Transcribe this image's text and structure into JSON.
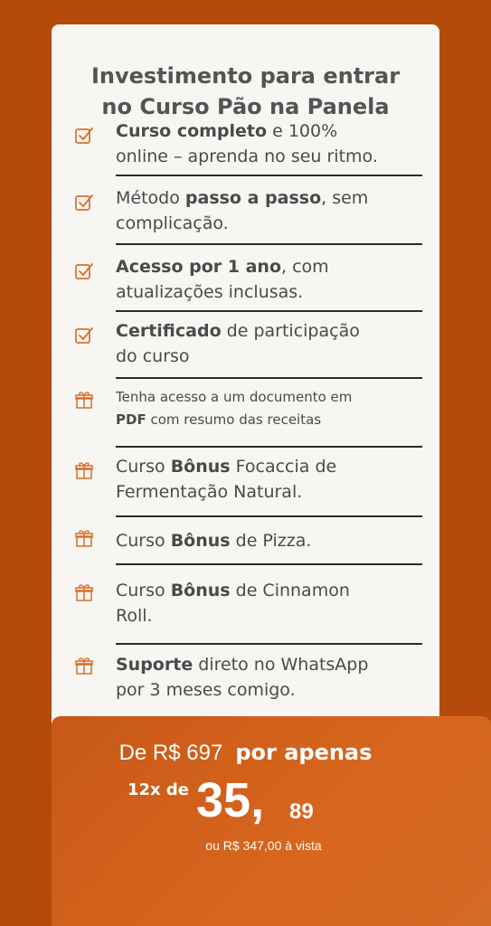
{
  "title": {
    "line1": "Investimento para entrar",
    "line2": "no Curso Pão na Panela"
  },
  "items": [
    {
      "icon": "checkbox-icon",
      "bold1": "Curso completo",
      "text1": " e 100%",
      "line2": "online – aprenda no seu ritmo."
    },
    {
      "icon": "checkbox-icon",
      "pre": "Método ",
      "bold1": "passo a passo",
      "text1": ", sem",
      "line2": "complicação."
    },
    {
      "icon": "checkbox-icon",
      "bold1": "Acesso por 1 ano",
      "text1": ", com",
      "line2": "atualizações inclusas."
    },
    {
      "icon": "checkbox-icon",
      "bold1": "Certificado",
      "text1": " de participação",
      "line2": "do curso"
    },
    {
      "icon": "gift-icon",
      "text1": "Tenha acesso a um documento em",
      "bold2": "PDF",
      "line2": " com resumo das receitas"
    },
    {
      "icon": "gift-icon",
      "pre": "Curso ",
      "bold1": "Bônus",
      "text1": " Focaccia de",
      "line2": "Fermentação Natural."
    },
    {
      "icon": "gift-icon",
      "pre": "Curso ",
      "bold1": "Bônus",
      "text1": " de Pizza."
    },
    {
      "icon": "gift-icon",
      "pre": "Curso ",
      "bold1": "Bônus",
      "text1": " de Cinnamon",
      "line2": "Roll."
    },
    {
      "icon": "gift-icon",
      "bold1": "Suporte",
      "text1": " direto no WhatsApp",
      "line2": "por  3 meses comigo."
    }
  ],
  "price": {
    "from": "De R$ 697",
    "only": "por apenas",
    "installments": "12x de",
    "amount": "35,",
    "cents": "89",
    "cash": "ou R$ 347,00 à vista"
  },
  "colors": {
    "background": "#b54b0a",
    "accent": "#d8661e",
    "icon": "#d86f2b"
  }
}
